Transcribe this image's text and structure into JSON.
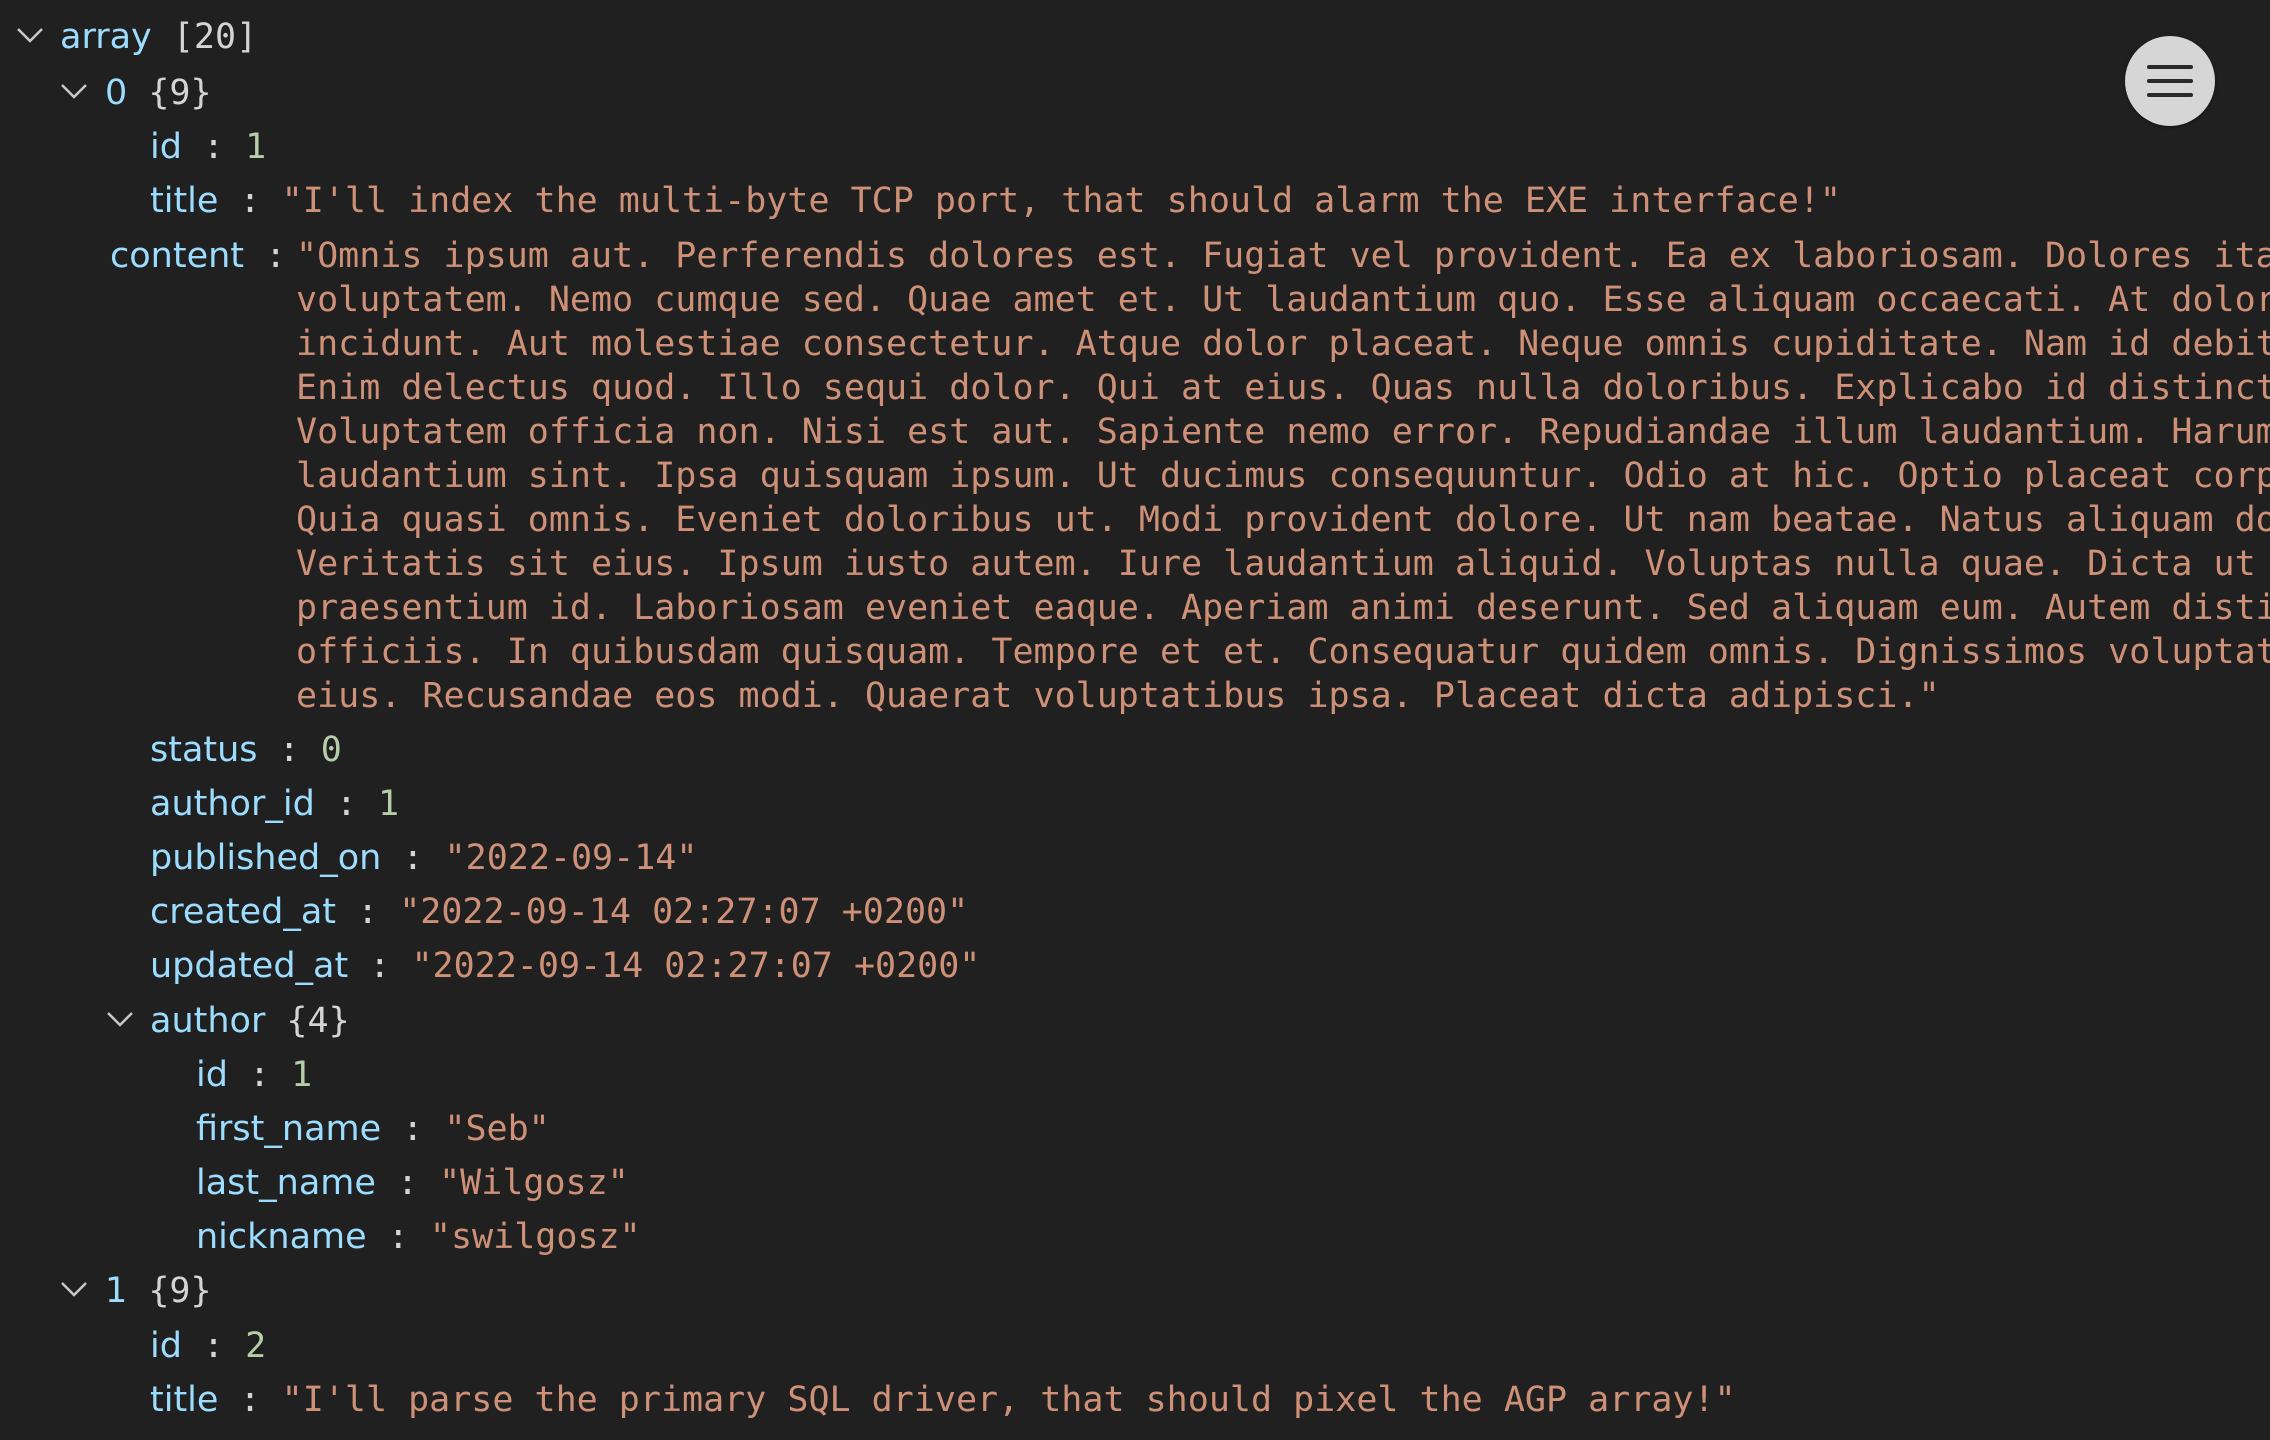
{
  "tree": {
    "root": {
      "key": "array",
      "meta": "[20]"
    },
    "item0": {
      "key": "0",
      "meta": "{9}",
      "fields": [
        {
          "key": "id",
          "value": "1",
          "type": "num"
        },
        {
          "key": "title",
          "value": "\"I'll index the multi-byte TCP port, that should alarm the EXE interface!\"",
          "type": "str"
        }
      ],
      "content": {
        "key": "content",
        "lines": [
          "\"Omnis ipsum aut. Perferendis dolores est. Fugiat vel provident. Ea ex laboriosam. Dolores itaque",
          "voluptatem. Nemo cumque sed. Quae amet et. Ut laudantium quo. Esse aliquam occaecati. At dolores",
          "incidunt. Aut molestiae consectetur. Atque dolor placeat. Neque omnis cupiditate. Nam id debitis.",
          "Enim delectus quod. Illo sequi dolor. Qui at eius. Quas nulla doloribus. Explicabo id distinctio.",
          "Voluptatem officia non. Nisi est aut. Sapiente nemo error. Repudiandae illum laudantium. Harum",
          "laudantium sint. Ipsa quisquam ipsum. Ut ducimus consequuntur. Odio at hic. Optio placeat corporis.",
          "Quia quasi omnis. Eveniet doloribus ut. Modi provident dolore. Ut nam beatae. Natus aliquam dolorum.",
          "Veritatis sit eius. Ipsum iusto autem. Iure laudantium aliquid. Voluptas nulla quae. Dicta ut ab. Ab",
          "praesentium id. Laboriosam eveniet eaque. Aperiam animi deserunt. Sed aliquam eum. Autem distinctio",
          "officiis. In quibusdam quisquam. Tempore et et. Consequatur quidem omnis. Dignissimos voluptatem",
          "eius. Recusandae eos modi. Quaerat voluptatibus ipsa. Placeat dicta adipisci.\""
        ]
      },
      "fields_after": [
        {
          "key": "status",
          "value": "0",
          "type": "num"
        },
        {
          "key": "author_id",
          "value": "1",
          "type": "num"
        },
        {
          "key": "published_on",
          "value": "\"2022-09-14\"",
          "type": "str"
        },
        {
          "key": "created_at",
          "value": "\"2022-09-14 02:27:07 +0200\"",
          "type": "str"
        },
        {
          "key": "updated_at",
          "value": "\"2022-09-14 02:27:07 +0200\"",
          "type": "str"
        }
      ],
      "author": {
        "key": "author",
        "meta": "{4}",
        "fields": [
          {
            "key": "id",
            "value": "1",
            "type": "num"
          },
          {
            "key": "first_name",
            "value": "\"Seb\"",
            "type": "str"
          },
          {
            "key": "last_name",
            "value": "\"Wilgosz\"",
            "type": "str"
          },
          {
            "key": "nickname",
            "value": "\"swilgosz\"",
            "type": "str"
          }
        ]
      }
    },
    "item1": {
      "key": "1",
      "meta": "{9}",
      "fields": [
        {
          "key": "id",
          "value": "2",
          "type": "num"
        },
        {
          "key": "title",
          "value": "\"I'll parse the primary SQL driver, that should pixel the AGP array!\"",
          "type": "str"
        }
      ]
    }
  },
  "menu": {
    "icon": "hamburger-menu-icon"
  },
  "colors": {
    "background": "#202020",
    "key": "#9cdcfe",
    "string": "#ce9178",
    "number": "#b5cea8",
    "menu_button": "#d6d6d6"
  }
}
